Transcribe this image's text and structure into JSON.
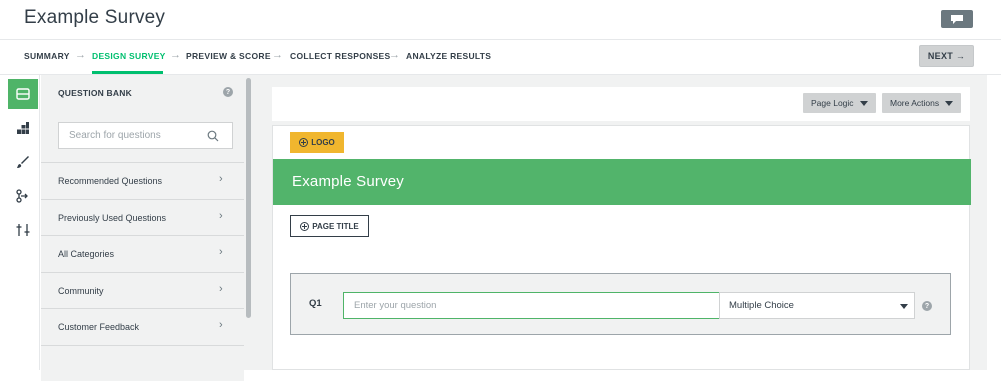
{
  "header": {
    "survey_title": "Example Survey"
  },
  "nav": {
    "steps": [
      {
        "label": "SUMMARY"
      },
      {
        "label": "DESIGN SURVEY"
      },
      {
        "label": "PREVIEW & SCORE"
      },
      {
        "label": "COLLECT RESPONSES"
      },
      {
        "label": "ANALYZE RESULTS"
      }
    ],
    "arrow": "→",
    "next_label": "NEXT →"
  },
  "rail": {
    "items": [
      {
        "icon": "question-bank-icon"
      },
      {
        "icon": "builder-icon"
      },
      {
        "icon": "style-brush-icon"
      },
      {
        "icon": "logic-icon"
      },
      {
        "icon": "options-sliders-icon"
      }
    ]
  },
  "bank": {
    "title": "QUESTION BANK",
    "help": "?",
    "search_placeholder": "Search for questions",
    "chevron": "›",
    "items": [
      {
        "label": "Recommended Questions"
      },
      {
        "label": "Previously Used Questions"
      },
      {
        "label": "All Categories"
      },
      {
        "label": "Community"
      },
      {
        "label": "Customer Feedback"
      }
    ]
  },
  "toolbar": {
    "page_logic": "Page Logic",
    "more_actions": "More Actions"
  },
  "survey": {
    "logo_label": "LOGO",
    "title": "Example Survey",
    "page_title_label": "PAGE TITLE",
    "question": {
      "number": "Q1",
      "placeholder": "Enter your question",
      "type": "Multiple Choice",
      "help": "?"
    }
  },
  "colors": {
    "accent": "#00bf6f",
    "banner": "#52b46b",
    "logo": "#f0b62e"
  }
}
